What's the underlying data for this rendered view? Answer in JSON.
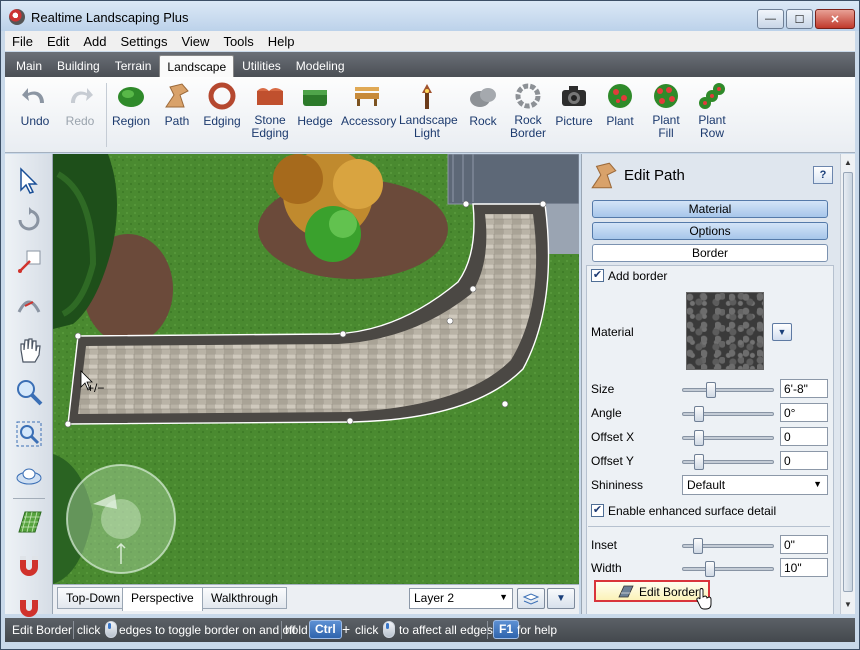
{
  "window": {
    "title": "Realtime Landscaping Plus",
    "controls": {
      "minimize": "—",
      "maximize": "☐",
      "close": "✕"
    }
  },
  "menu": [
    "File",
    "Edit",
    "Add",
    "Settings",
    "View",
    "Tools",
    "Help"
  ],
  "main_tabs": {
    "items": [
      "Main",
      "Building",
      "Terrain",
      "Landscape",
      "Utilities",
      "Modeling"
    ],
    "active": "Landscape"
  },
  "toolbar": {
    "undo": "Undo",
    "redo": "Redo",
    "region": "Region",
    "path": "Path",
    "edging": "Edging",
    "stone_edging": "Stone\nEdging",
    "hedge": "Hedge",
    "accessory": "Accessory",
    "landscape_light": "Landscape\nLight",
    "rock": "Rock",
    "rock_border": "Rock\nBorder",
    "picture": "Picture",
    "plant": "Plant",
    "plant_fill": "Plant\nFill",
    "plant_row": "Plant\nRow"
  },
  "left_tools": [
    "select-arrow-icon",
    "rotate-icon",
    "resize-icon",
    "arc-icon",
    "pan-hand-icon",
    "zoom-icon",
    "zoom-extents-icon",
    "orbit-icon",
    "grid-icon",
    "magnet-icon",
    "snap-icon"
  ],
  "viewport": {
    "view_tabs": [
      "Top-Down",
      "Perspective",
      "Walkthrough"
    ],
    "active_view": "Perspective",
    "layer": "Layer 2"
  },
  "panel": {
    "title": "Edit Path",
    "help": "?",
    "sections": {
      "material": "Material",
      "options": "Options",
      "border": "Border"
    },
    "add_border_label": "Add border",
    "add_border_checked": true,
    "material_label": "Material",
    "size": {
      "label": "Size",
      "value": "6'-8\"",
      "level": 0.29
    },
    "angle": {
      "label": "Angle",
      "value": "0°",
      "level": 0.14
    },
    "offset_x": {
      "label": "Offset X",
      "value": "0",
      "level": 0.14
    },
    "offset_y": {
      "label": "Offset Y",
      "value": "0",
      "level": 0.14
    },
    "shininess": {
      "label": "Shininess",
      "value": "Default"
    },
    "enhanced_label": "Enable enhanced surface detail",
    "enhanced_checked": true,
    "inset": {
      "label": "Inset",
      "value": "0\"",
      "level": 0.12
    },
    "width": {
      "label": "Width",
      "value": "10\"",
      "level": 0.28
    },
    "edit_border_button": "Edit Border"
  },
  "status": {
    "mode": "Edit Border",
    "click1": "click",
    "text1": "edges to toggle border on and off",
    "hold": "hold",
    "ctrl_key": "Ctrl",
    "plus": "+",
    "click2": "click",
    "text2": "to affect all edges",
    "f1_key": "F1",
    "help_text": "for help"
  },
  "colors": {
    "accent": "#2f64ad",
    "grass": "#3f7d2a",
    "highlight_border": "#d9343b"
  }
}
